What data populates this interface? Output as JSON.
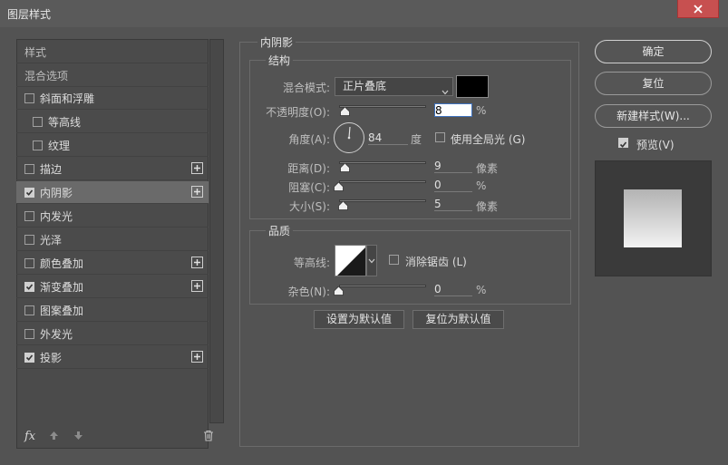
{
  "window": {
    "title": "图层样式"
  },
  "sidebar": {
    "items": [
      {
        "label": "样式",
        "type": "header"
      },
      {
        "label": "混合选项",
        "type": "header"
      },
      {
        "label": "斜面和浮雕",
        "checked": false,
        "indent": false,
        "plus": false
      },
      {
        "label": "等高线",
        "checked": false,
        "indent": true,
        "plus": false
      },
      {
        "label": "纹理",
        "checked": false,
        "indent": true,
        "plus": false
      },
      {
        "label": "描边",
        "checked": false,
        "indent": false,
        "plus": true
      },
      {
        "label": "内阴影",
        "checked": true,
        "indent": false,
        "plus": true,
        "selected": true
      },
      {
        "label": "内发光",
        "checked": false,
        "indent": false,
        "plus": false
      },
      {
        "label": "光泽",
        "checked": false,
        "indent": false,
        "plus": false
      },
      {
        "label": "颜色叠加",
        "checked": false,
        "indent": false,
        "plus": true
      },
      {
        "label": "渐变叠加",
        "checked": true,
        "indent": false,
        "plus": true
      },
      {
        "label": "图案叠加",
        "checked": false,
        "indent": false,
        "plus": false
      },
      {
        "label": "外发光",
        "checked": false,
        "indent": false,
        "plus": false
      },
      {
        "label": "投影",
        "checked": true,
        "indent": false,
        "plus": true
      }
    ],
    "fx_label": "fx"
  },
  "inner_shadow": {
    "section_title": "内阴影",
    "structure_title": "结构",
    "blend_mode_label": "混合模式:",
    "blend_mode_value": "正片叠底",
    "shadow_color": "#000000",
    "opacity_label": "不透明度(O):",
    "opacity_value": "8",
    "opacity_unit": "%",
    "angle_label": "角度(A):",
    "angle_value": "84",
    "angle_unit": "度",
    "global_light_label": "使用全局光 (G)",
    "global_light_checked": false,
    "distance_label": "距离(D):",
    "distance_value": "9",
    "distance_unit": "像素",
    "choke_label": "阻塞(C):",
    "choke_value": "0",
    "choke_unit": "%",
    "size_label": "大小(S):",
    "size_value": "5",
    "size_unit": "像素",
    "quality_title": "品质",
    "contour_label": "等高线:",
    "antialias_label": "消除锯齿 (L)",
    "antialias_checked": false,
    "noise_label": "杂色(N):",
    "noise_value": "0",
    "noise_unit": "%",
    "set_default_label": "设置为默认值",
    "reset_default_label": "复位为默认值"
  },
  "actions": {
    "ok_label": "确定",
    "reset_label": "复位",
    "new_style_label": "新建样式(W)...",
    "preview_label": "预览(V)",
    "preview_checked": true
  }
}
